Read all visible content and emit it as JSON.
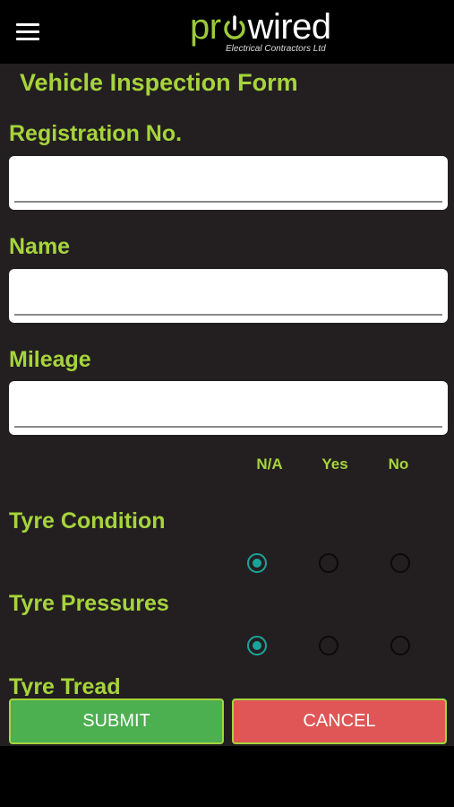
{
  "header": {
    "logo_pr": "pr",
    "logo_wired": "wired",
    "tagline": "Electrical Contractors Ltd"
  },
  "form": {
    "title": "Vehicle Inspection Form",
    "fields": [
      {
        "label": "Registration No.",
        "value": ""
      },
      {
        "label": "Name",
        "value": ""
      },
      {
        "label": "Mileage",
        "value": ""
      }
    ],
    "columns": [
      "N/A",
      "Yes",
      "No"
    ],
    "questions": [
      {
        "label": "Tyre Condition",
        "selected": "N/A"
      },
      {
        "label": "Tyre Pressures",
        "selected": "N/A"
      },
      {
        "label": "Tyre Tread",
        "selected": ""
      }
    ]
  },
  "buttons": {
    "submit": "SUBMIT",
    "cancel": "CANCEL"
  },
  "colors": {
    "accent": "#a6d43c",
    "background": "#231f20",
    "submit": "#4caf50",
    "cancel": "#e05555",
    "radio_selected": "#1aa39a"
  }
}
